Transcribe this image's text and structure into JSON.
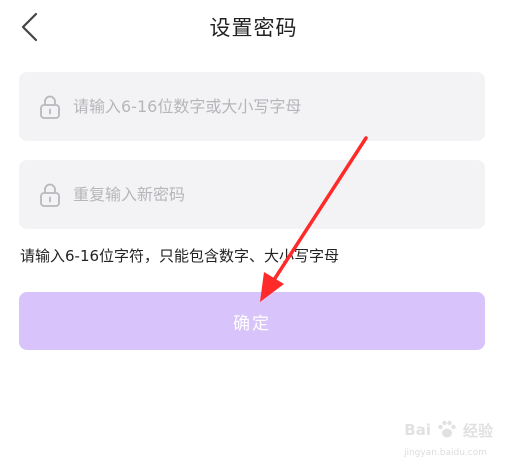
{
  "header": {
    "title": "设置密码",
    "back_icon": "chevron-left-icon"
  },
  "form": {
    "new_password": {
      "placeholder": "请输入6-16位数字或大小写字母",
      "value": "",
      "icon": "lock-icon"
    },
    "repeat_password": {
      "placeholder": "重复输入新密码",
      "value": "",
      "icon": "lock-icon"
    },
    "hint": "请输入6-16位字符，只能包含数字、大小写字母"
  },
  "confirm_button": {
    "label": "确定",
    "color": "#d8c4fb"
  },
  "annotation": {
    "type": "red-arrow",
    "color": "#ff2a2a"
  },
  "watermark": {
    "text_left": "Bai",
    "text_right": "经验",
    "sub": "jingyan.baidu.com",
    "icon": "paw-icon"
  }
}
